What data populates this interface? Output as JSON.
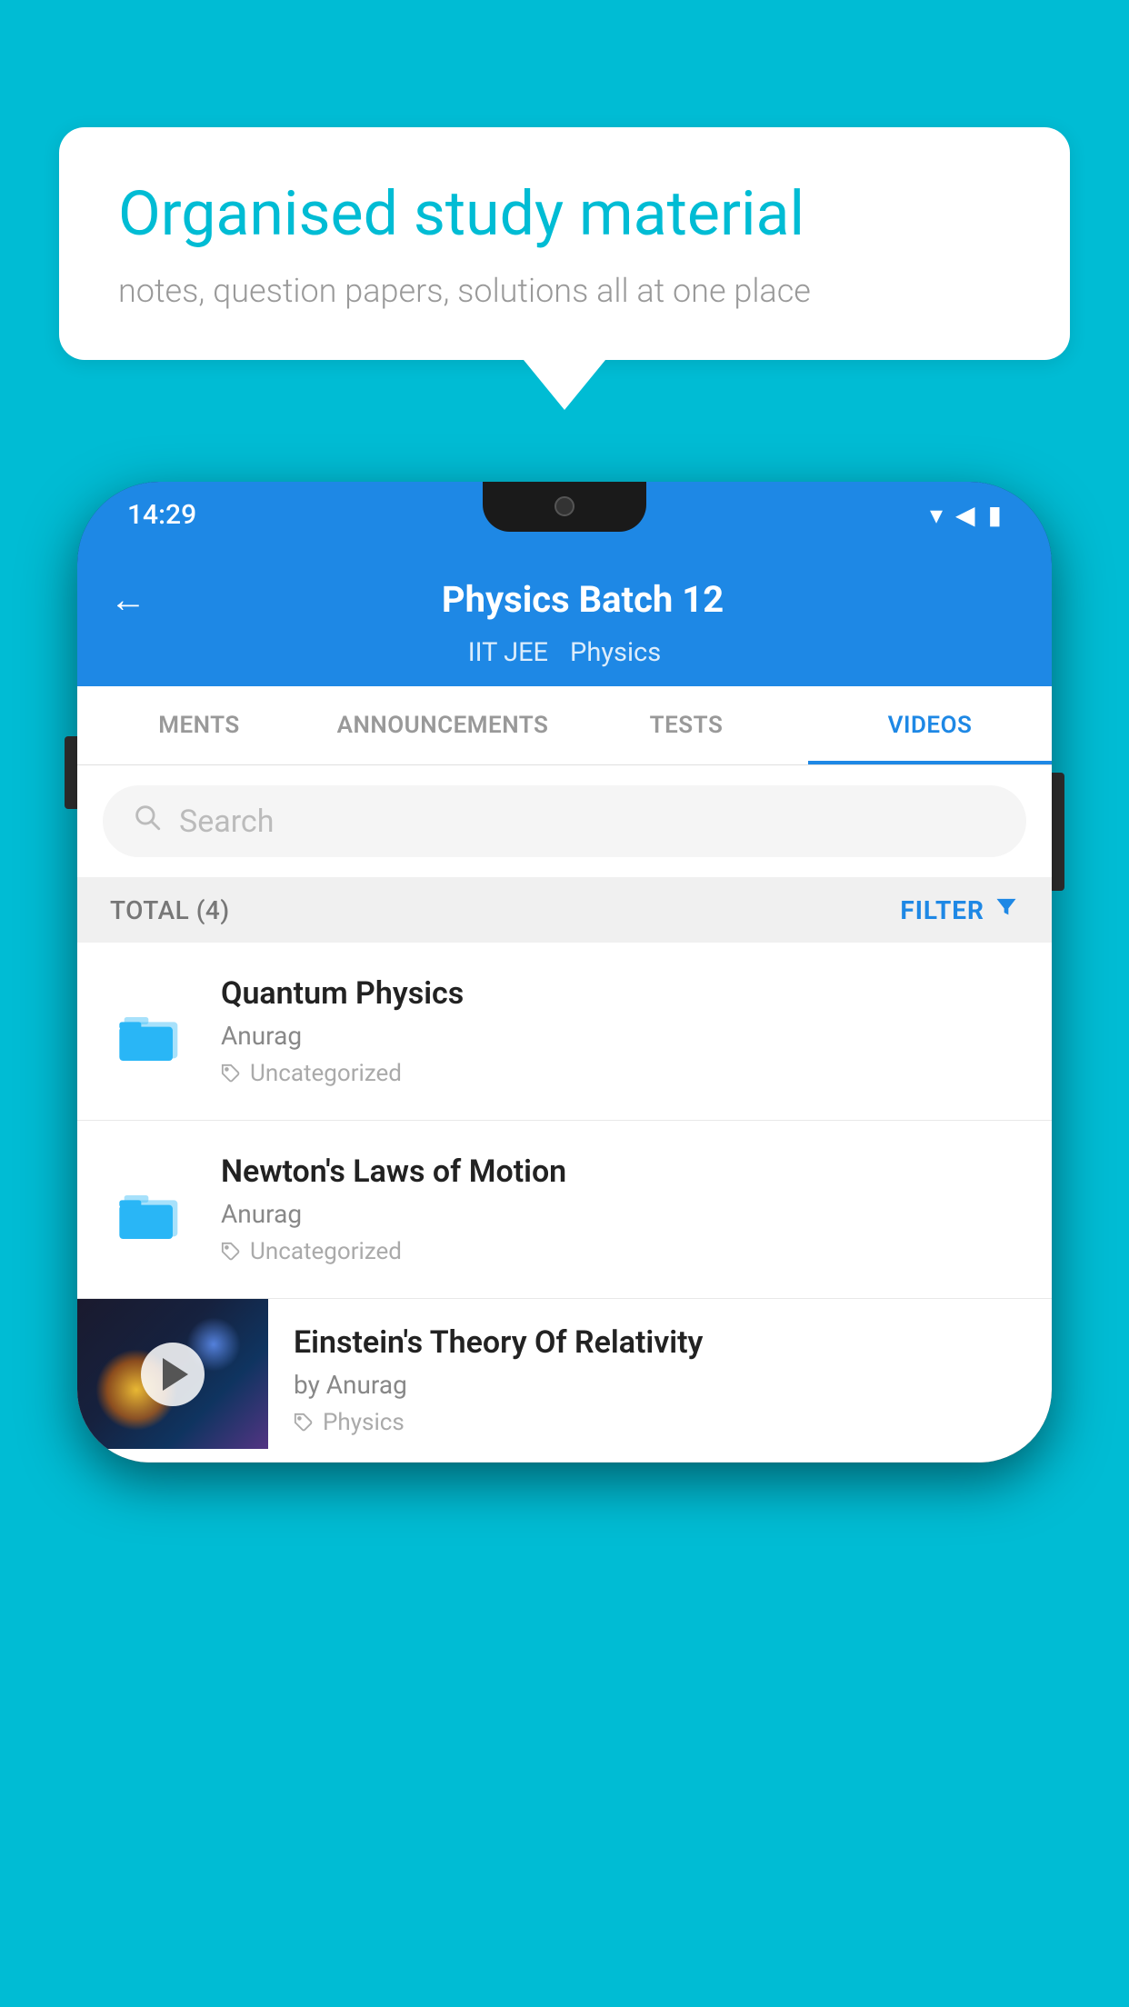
{
  "background_color": "#00bcd4",
  "speech_bubble": {
    "title": "Organised study material",
    "subtitle": "notes, question papers, solutions all at one place"
  },
  "phone": {
    "status_bar": {
      "time": "14:29",
      "icons": [
        "wifi",
        "signal",
        "battery"
      ]
    },
    "app_header": {
      "back_label": "←",
      "title": "Physics Batch 12",
      "tags": [
        "IIT JEE",
        "Physics"
      ]
    },
    "tabs": [
      {
        "label": "MENTS",
        "active": false
      },
      {
        "label": "ANNOUNCEMENTS",
        "active": false
      },
      {
        "label": "TESTS",
        "active": false
      },
      {
        "label": "VIDEOS",
        "active": true
      }
    ],
    "search": {
      "placeholder": "Search"
    },
    "filter_bar": {
      "total_label": "TOTAL (4)",
      "filter_label": "FILTER"
    },
    "list_items": [
      {
        "type": "folder",
        "title": "Quantum Physics",
        "author": "Anurag",
        "tag": "Uncategorized"
      },
      {
        "type": "folder",
        "title": "Newton's Laws of Motion",
        "author": "Anurag",
        "tag": "Uncategorized"
      }
    ],
    "video_item": {
      "title": "Einstein's Theory Of Relativity",
      "author": "by Anurag",
      "tag": "Physics"
    }
  }
}
